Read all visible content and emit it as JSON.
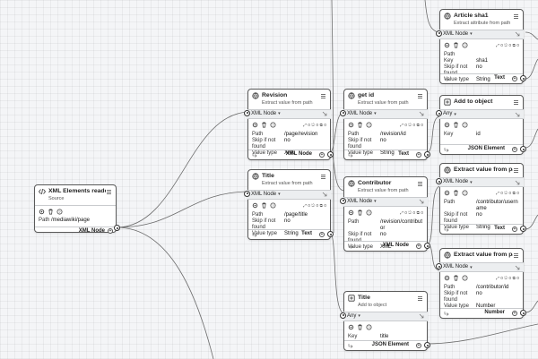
{
  "canvas": {
    "accent": "#333333",
    "edge_color": "#6b6b6b"
  },
  "icons": {
    "toolbar": [
      "gear-icon",
      "trash-icon",
      "help-icon"
    ],
    "menu": "hamburger-icon"
  },
  "nodes": {
    "reader": {
      "title": "XML Elements reader",
      "subtitle": "Source",
      "stats": "",
      "path_label": "Path",
      "path_value": "/mediawiki/page",
      "output_type": "XML Node"
    },
    "revision": {
      "title": "Revision",
      "subtitle": "Extract value from path",
      "input_type": "XML Node",
      "stats": "⤢ 0  ⎋ 0  ⧉ 0",
      "props": [
        {
          "k": "Path",
          "v": "/page/revision"
        },
        {
          "k": "Skip if not found",
          "v": "no"
        },
        {
          "k": "Value type",
          "v": "XML"
        }
      ],
      "output_type": "XML Node"
    },
    "title_xml": {
      "title": "Title",
      "subtitle": "Extract value from path",
      "input_type": "XML Node",
      "stats": "⤢ 0  ⎋ 0  ⧉ 0",
      "props": [
        {
          "k": "Path",
          "v": "/page/title"
        },
        {
          "k": "Skip if not found",
          "v": "no"
        },
        {
          "k": "Value type",
          "v": "String"
        }
      ],
      "output_type": "Text"
    },
    "get_id": {
      "title": "get id",
      "subtitle": "Extract value from path",
      "input_type": "XML Node",
      "stats": "⤢ 0  ⎋ 0  ⧉ 0",
      "props": [
        {
          "k": "Path",
          "v": "/revision/id"
        },
        {
          "k": "Skip if not found",
          "v": "no"
        },
        {
          "k": "Value type",
          "v": "String"
        }
      ],
      "output_type": "Text"
    },
    "contributor": {
      "title": "Contributor",
      "subtitle": "Extract value from path",
      "input_type": "XML Node",
      "stats": "⤢ 0  ⎋ 0  ⧉ 0",
      "props": [
        {
          "k": "Path",
          "v": "/revision/contributor"
        },
        {
          "k": "Skip if not found",
          "v": "no"
        },
        {
          "k": "Value type",
          "v": "XML"
        }
      ],
      "output_type": "XML Node"
    },
    "title_json": {
      "title": "Title",
      "subtitle": "Add to object",
      "input_type": "Any",
      "stats": "",
      "props": [
        {
          "k": "Key",
          "v": "title"
        }
      ],
      "output_type": "JSON Element"
    },
    "article_sha1": {
      "title": "Article sha1",
      "subtitle": "Extract attribute from path",
      "input_type": "XML Node",
      "stats": "⤢ 0  ⎋ 0  ⧉ 0",
      "props": [
        {
          "k": "Path",
          "v": ""
        },
        {
          "k": "Key",
          "v": "sha1"
        },
        {
          "k": "Skip if not found",
          "v": "no"
        },
        {
          "k": "Value type",
          "v": "String"
        }
      ],
      "output_type": "Text"
    },
    "add_object": {
      "title": "Add to object",
      "subtitle": "",
      "input_type": "Any",
      "stats": "",
      "props": [
        {
          "k": "Key",
          "v": "id"
        }
      ],
      "output_type": "JSON Element"
    },
    "extract_user": {
      "title": "Extract value from path",
      "subtitle": "",
      "input_type": "XML Node",
      "stats": "⤢ 0  ⎋ 0  ⧉ 0",
      "props": [
        {
          "k": "Path",
          "v": "/contributor/username"
        },
        {
          "k": "Skip if not found",
          "v": "no"
        },
        {
          "k": "Value type",
          "v": "String"
        }
      ],
      "output_type": "Text"
    },
    "extract_id": {
      "title": "Extract value from path",
      "subtitle": "",
      "input_type": "XML Node",
      "stats": "⤢ 0  ⎋ 0  ⧉ 0",
      "props": [
        {
          "k": "Path",
          "v": "/contributor/id"
        },
        {
          "k": "Skip if not found",
          "v": "no"
        },
        {
          "k": "Value type",
          "v": "Number"
        }
      ],
      "output_type": "Number"
    }
  }
}
